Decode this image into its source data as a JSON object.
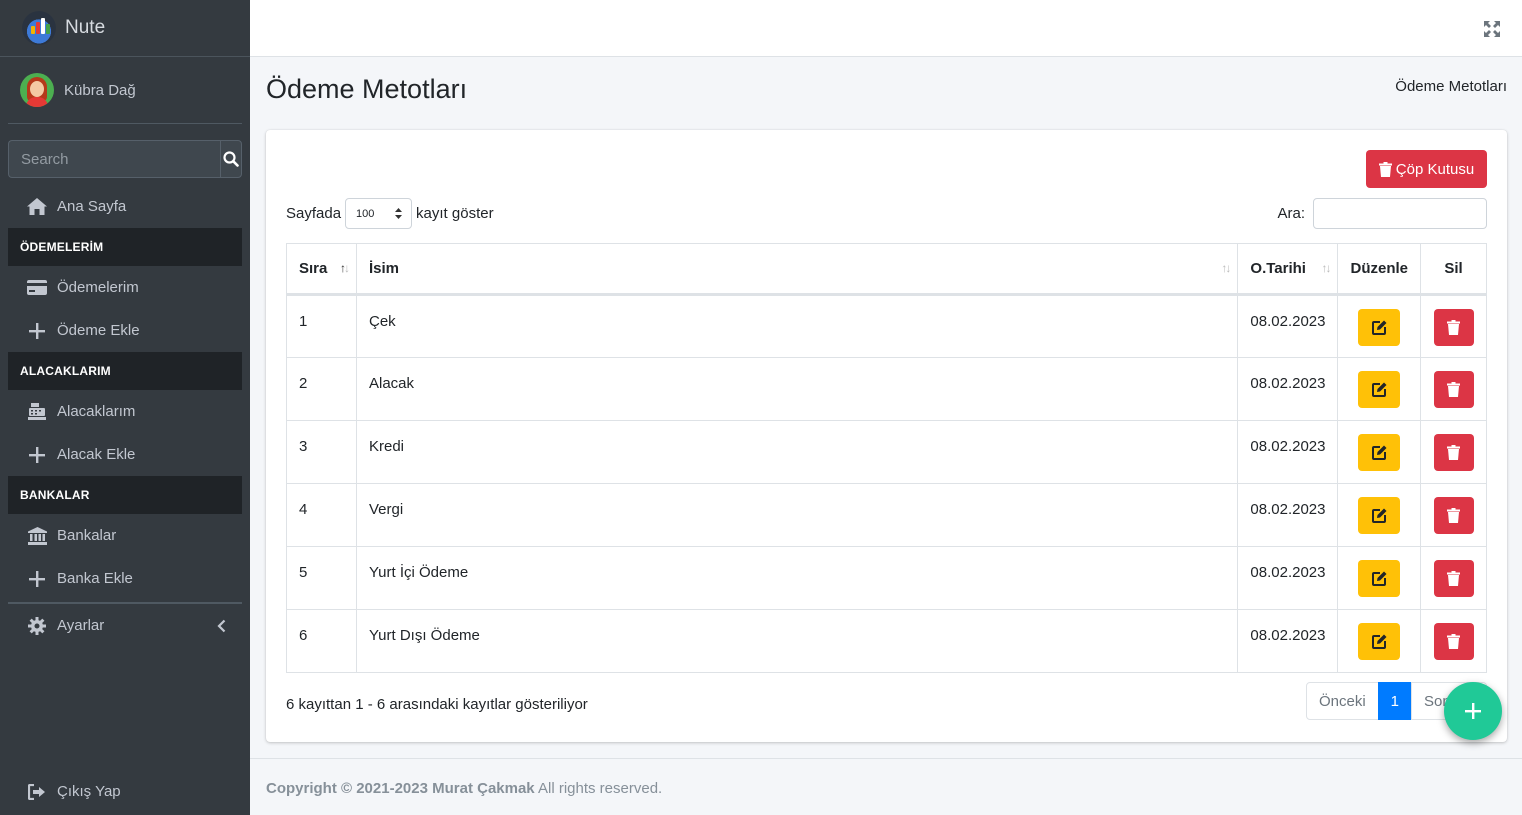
{
  "brand": {
    "name": "Nute"
  },
  "user": {
    "name": "Kübra Dağ"
  },
  "sidebar": {
    "search_placeholder": "Search",
    "home": "Ana Sayfa",
    "headers": [
      "ÖDEMELERİM",
      "ALACAKLARIM",
      "BANKALAR"
    ],
    "items": [
      {
        "label": "Ödemelerim",
        "icon": "credit-card-icon"
      },
      {
        "label": "Ödeme Ekle",
        "icon": "plus-icon"
      },
      {
        "label": "Alacaklarım",
        "icon": "cash-register-icon"
      },
      {
        "label": "Alacak Ekle",
        "icon": "plus-icon"
      },
      {
        "label": "Bankalar",
        "icon": "bank-icon"
      },
      {
        "label": "Banka Ekle",
        "icon": "plus-icon"
      }
    ],
    "settings": "Ayarlar",
    "logout": "Çıkış Yap"
  },
  "page": {
    "title": "Ödeme Metotları",
    "breadcrumb": "Ödeme Metotları"
  },
  "card": {
    "trash_button": "Çöp Kutusu",
    "length_prefix": "Sayfada",
    "length_value": "100",
    "length_suffix": "kayıt göster",
    "search_label": "Ara:"
  },
  "table": {
    "headers": {
      "sira": "Sıra",
      "isim": "İsim",
      "tarih": "O.Tarihi",
      "duzenle": "Düzenle",
      "sil": "Sil"
    },
    "rows": [
      {
        "sira": "1",
        "isim": "Çek",
        "tarih": "08.02.2023"
      },
      {
        "sira": "2",
        "isim": "Alacak",
        "tarih": "08.02.2023"
      },
      {
        "sira": "3",
        "isim": "Kredi",
        "tarih": "08.02.2023"
      },
      {
        "sira": "4",
        "isim": "Vergi",
        "tarih": "08.02.2023"
      },
      {
        "sira": "5",
        "isim": "Yurt İçi Ödeme",
        "tarih": "08.02.2023"
      },
      {
        "sira": "6",
        "isim": "Yurt Dışı Ödeme",
        "tarih": "08.02.2023"
      }
    ]
  },
  "info": "6 kayıttan 1 - 6 arasındaki kayıtlar gösteriliyor",
  "pager": {
    "prev": "Önceki",
    "current": "1",
    "next": "Sonraki"
  },
  "footer": {
    "copyright": "Copyright © 2021-2023 Murat Çakmak",
    "rights": "All rights reserved."
  },
  "colors": {
    "sidebar_bg": "#343a40",
    "danger": "#dc3545",
    "warning": "#ffc107",
    "primary": "#007bff",
    "fab": "#20c997"
  }
}
